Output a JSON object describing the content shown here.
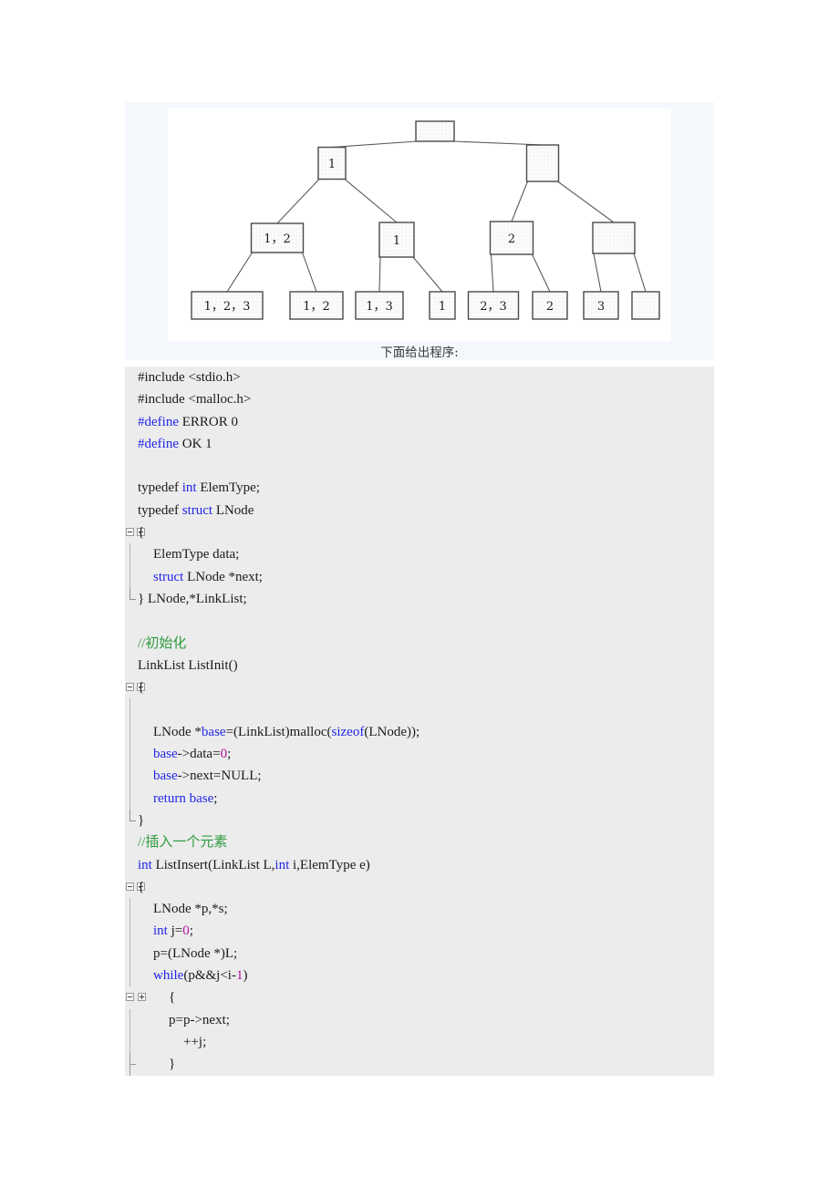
{
  "figure": {
    "caption": "下面给出程序:",
    "tree": {
      "levels": [
        {
          "nodes": [
            {
              "label": ""
            }
          ]
        },
        {
          "nodes": [
            {
              "label": "1"
            },
            {
              "label": ""
            }
          ]
        },
        {
          "nodes": [
            {
              "label": "1，2"
            },
            {
              "label": "1"
            },
            {
              "label": "2"
            },
            {
              "label": ""
            }
          ]
        },
        {
          "nodes": [
            {
              "label": "1，2，3"
            },
            {
              "label": "1，2"
            },
            {
              "label": "1，3"
            },
            {
              "label": "1"
            },
            {
              "label": "2，3"
            },
            {
              "label": "2"
            },
            {
              "label": "3"
            },
            {
              "label": ""
            }
          ]
        }
      ]
    }
  },
  "code": {
    "lines": [
      {
        "gutter": "none",
        "indent": 0,
        "tokens": [
          {
            "t": "#include <stdio.h>",
            "c": "plain"
          }
        ]
      },
      {
        "gutter": "none",
        "indent": 0,
        "tokens": [
          {
            "t": "#include <malloc.h>",
            "c": "plain"
          }
        ]
      },
      {
        "gutter": "none",
        "indent": 0,
        "tokens": [
          {
            "t": "#define",
            "c": "kw"
          },
          {
            "t": " ERROR 0",
            "c": "plain"
          }
        ]
      },
      {
        "gutter": "none",
        "indent": 0,
        "tokens": [
          {
            "t": "#define",
            "c": "kw"
          },
          {
            "t": " OK 1",
            "c": "plain"
          }
        ]
      },
      {
        "gutter": "none",
        "indent": 0,
        "tokens": []
      },
      {
        "gutter": "none",
        "indent": 0,
        "tokens": [
          {
            "t": "typedef ",
            "c": "plain"
          },
          {
            "t": "int",
            "c": "kw"
          },
          {
            "t": " ElemType;",
            "c": "plain"
          }
        ]
      },
      {
        "gutter": "none",
        "indent": 0,
        "tokens": [
          {
            "t": "typedef ",
            "c": "plain"
          },
          {
            "t": "struct",
            "c": "kw"
          },
          {
            "t": " LNode",
            "c": "plain"
          }
        ]
      },
      {
        "gutter": "fold",
        "indent": 0,
        "tokens": [
          {
            "t": "{",
            "c": "plain"
          }
        ]
      },
      {
        "gutter": "line",
        "indent": 1,
        "tokens": [
          {
            "t": "ElemType data;",
            "c": "plain"
          }
        ]
      },
      {
        "gutter": "line",
        "indent": 1,
        "tokens": [
          {
            "t": "struct",
            "c": "kw"
          },
          {
            "t": " LNode *next;",
            "c": "plain"
          }
        ]
      },
      {
        "gutter": "corner",
        "indent": 0,
        "tokens": [
          {
            "t": "} LNode,*LinkList;",
            "c": "plain"
          }
        ]
      },
      {
        "gutter": "none",
        "indent": 0,
        "tokens": []
      },
      {
        "gutter": "none",
        "indent": 0,
        "tokens": [
          {
            "t": "//初始化",
            "c": "cmt"
          }
        ]
      },
      {
        "gutter": "none",
        "indent": 0,
        "tokens": [
          {
            "t": "LinkList ListInit()",
            "c": "plain"
          }
        ]
      },
      {
        "gutter": "fold",
        "indent": 0,
        "tokens": [
          {
            "t": "{",
            "c": "plain"
          }
        ]
      },
      {
        "gutter": "line",
        "indent": 1,
        "tokens": []
      },
      {
        "gutter": "line",
        "indent": 1,
        "tokens": [
          {
            "t": "LNode *",
            "c": "plain"
          },
          {
            "t": "base",
            "c": "id"
          },
          {
            "t": "=(LinkList)malloc(",
            "c": "plain"
          },
          {
            "t": "sizeof",
            "c": "kw"
          },
          {
            "t": "(LNode));",
            "c": "plain"
          }
        ]
      },
      {
        "gutter": "line",
        "indent": 1,
        "tokens": [
          {
            "t": "base",
            "c": "id"
          },
          {
            "t": "->data=",
            "c": "plain"
          },
          {
            "t": "0",
            "c": "num"
          },
          {
            "t": ";",
            "c": "plain"
          }
        ]
      },
      {
        "gutter": "line",
        "indent": 1,
        "tokens": [
          {
            "t": "base",
            "c": "id"
          },
          {
            "t": "->next=NULL;",
            "c": "plain"
          }
        ]
      },
      {
        "gutter": "line",
        "indent": 1,
        "tokens": [
          {
            "t": "return",
            "c": "kw"
          },
          {
            "t": " ",
            "c": "plain"
          },
          {
            "t": "base",
            "c": "id"
          },
          {
            "t": ";",
            "c": "plain"
          }
        ]
      },
      {
        "gutter": "corner",
        "indent": 0,
        "tokens": [
          {
            "t": "}",
            "c": "plain"
          }
        ]
      },
      {
        "gutter": "none",
        "indent": 0,
        "tokens": [
          {
            "t": "//插入一个元素",
            "c": "cmt"
          }
        ]
      },
      {
        "gutter": "none",
        "indent": 0,
        "tokens": [
          {
            "t": "int",
            "c": "kw"
          },
          {
            "t": " ListInsert(LinkList L,",
            "c": "plain"
          },
          {
            "t": "int",
            "c": "kw"
          },
          {
            "t": " i,ElemType e)",
            "c": "plain"
          }
        ]
      },
      {
        "gutter": "fold",
        "indent": 0,
        "tokens": [
          {
            "t": "{",
            "c": "plain"
          }
        ]
      },
      {
        "gutter": "line",
        "indent": 1,
        "tokens": [
          {
            "t": "LNode *p,*s;",
            "c": "plain"
          }
        ]
      },
      {
        "gutter": "line",
        "indent": 1,
        "tokens": [
          {
            "t": "int",
            "c": "kw"
          },
          {
            "t": " j=",
            "c": "plain"
          },
          {
            "t": "0",
            "c": "num"
          },
          {
            "t": ";",
            "c": "plain"
          }
        ]
      },
      {
        "gutter": "line",
        "indent": 1,
        "tokens": [
          {
            "t": "p=(LNode *)L;",
            "c": "plain"
          }
        ]
      },
      {
        "gutter": "line",
        "indent": 1,
        "tokens": [
          {
            "t": "while",
            "c": "kw"
          },
          {
            "t": "(p&&j<i-",
            "c": "plain"
          },
          {
            "t": "1",
            "c": "num"
          },
          {
            "t": ")",
            "c": "plain"
          }
        ]
      },
      {
        "gutter": "fold-inner",
        "indent": 2,
        "tokens": [
          {
            "t": "{",
            "c": "plain"
          }
        ]
      },
      {
        "gutter": "line",
        "indent": 2,
        "tokens": [
          {
            "t": "p=p->next;",
            "c": "plain"
          }
        ]
      },
      {
        "gutter": "line",
        "indent": 3,
        "tokens": [
          {
            "t": "++j;",
            "c": "plain"
          }
        ]
      },
      {
        "gutter": "tee",
        "indent": 2,
        "tokens": [
          {
            "t": "}",
            "c": "plain"
          }
        ]
      }
    ]
  },
  "colors": {
    "keyword": "#2026e8",
    "number": "#b0119c",
    "comment": "#2e9b3f",
    "code_background": "#ececec",
    "figure_background": "#f4f8fc",
    "node_fill": "#f2f2f2",
    "node_stroke": "#4a4a4a"
  }
}
